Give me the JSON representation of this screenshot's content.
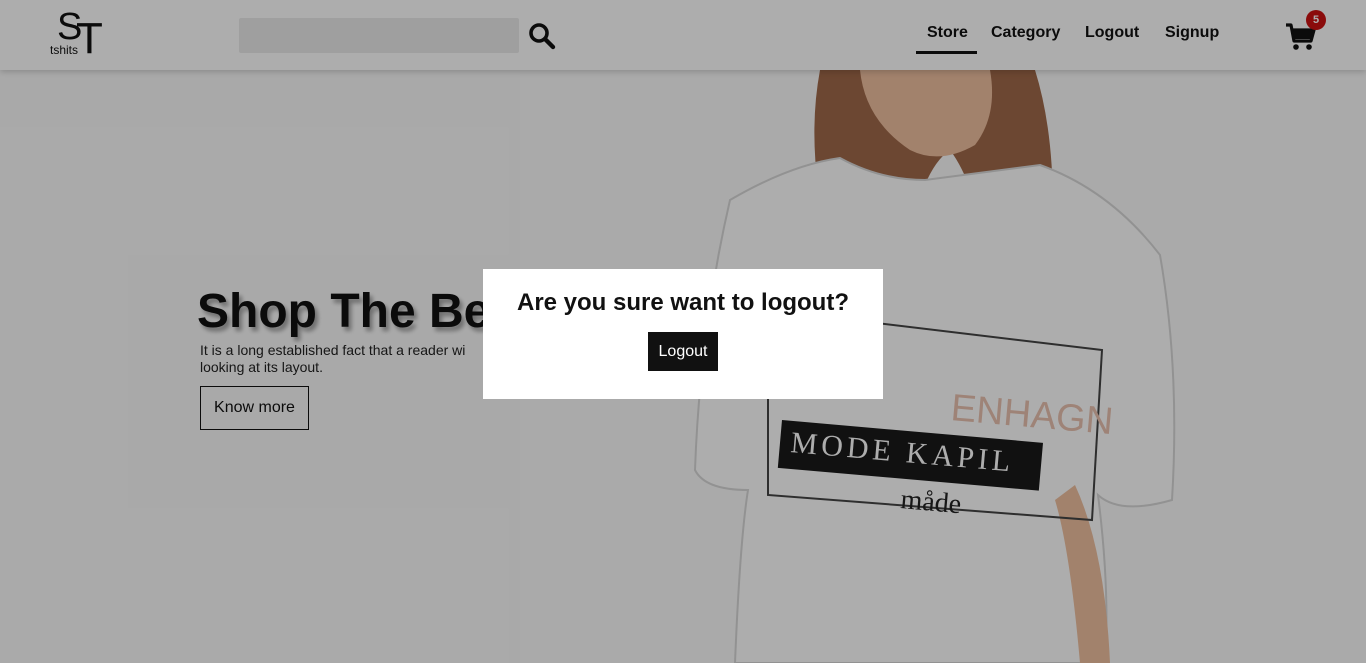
{
  "header": {
    "logo_letters_1": "S",
    "logo_letters_2": "T",
    "logo_sub": "tshits",
    "search_placeholder": "",
    "nav": {
      "store": "Store",
      "category": "Category",
      "logout": "Logout",
      "signup": "Signup"
    },
    "cart_count": "5"
  },
  "hero": {
    "title": "Shop The Be",
    "text": "It is a long established fact that a reader wi looking at its layout.",
    "button_label": "Know more",
    "shirt_print_1": "ENHAGN",
    "shirt_print_2": "MODE KAPIL",
    "shirt_print_3": "måde"
  },
  "modal": {
    "title": "Are you sure want to logout?",
    "button_label": "Logout"
  },
  "colors": {
    "accent": "#111111",
    "badge": "#cc1111"
  },
  "icons": [
    "search-icon",
    "cart-icon"
  ]
}
